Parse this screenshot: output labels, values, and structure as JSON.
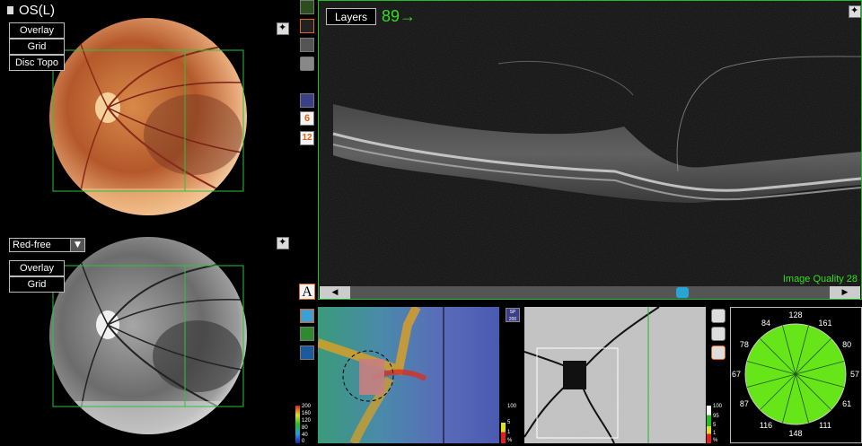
{
  "header": {
    "eye_label": "OS(L)"
  },
  "fundus_top": {
    "buttons": [
      "Overlay",
      "Grid",
      "Disc Topo"
    ]
  },
  "fundus_bottom": {
    "select_value": "Red-free",
    "buttons": [
      "Overlay",
      "Grid"
    ]
  },
  "bscan": {
    "layers_button": "Layers",
    "slice_label": "89→",
    "quality_label": "Image Quality 28",
    "left_arrow": "◀",
    "right_arrow": "▶"
  },
  "tools": {
    "annotate_icon": "A",
    "grid6_label": "6",
    "grid12_label": "12"
  },
  "thickness_map": {
    "scale_labels": [
      "200",
      "160",
      "120",
      "80",
      "40",
      "0"
    ],
    "sp_badge": "SP 200"
  },
  "deviation_scale_1": [
    "100",
    "5",
    "1",
    "%"
  ],
  "deviation_scale_2": [
    "100",
    "95",
    "5",
    "1",
    "%"
  ],
  "sector_chart": {
    "values": [
      "128",
      "161",
      "80",
      "57",
      "61",
      "111",
      "148",
      "116",
      "87",
      "67",
      "78",
      "84"
    ],
    "fill_color": "#66e619"
  },
  "colors": {
    "accent_green": "#33dd22",
    "frame_green": "#1cb82a"
  }
}
